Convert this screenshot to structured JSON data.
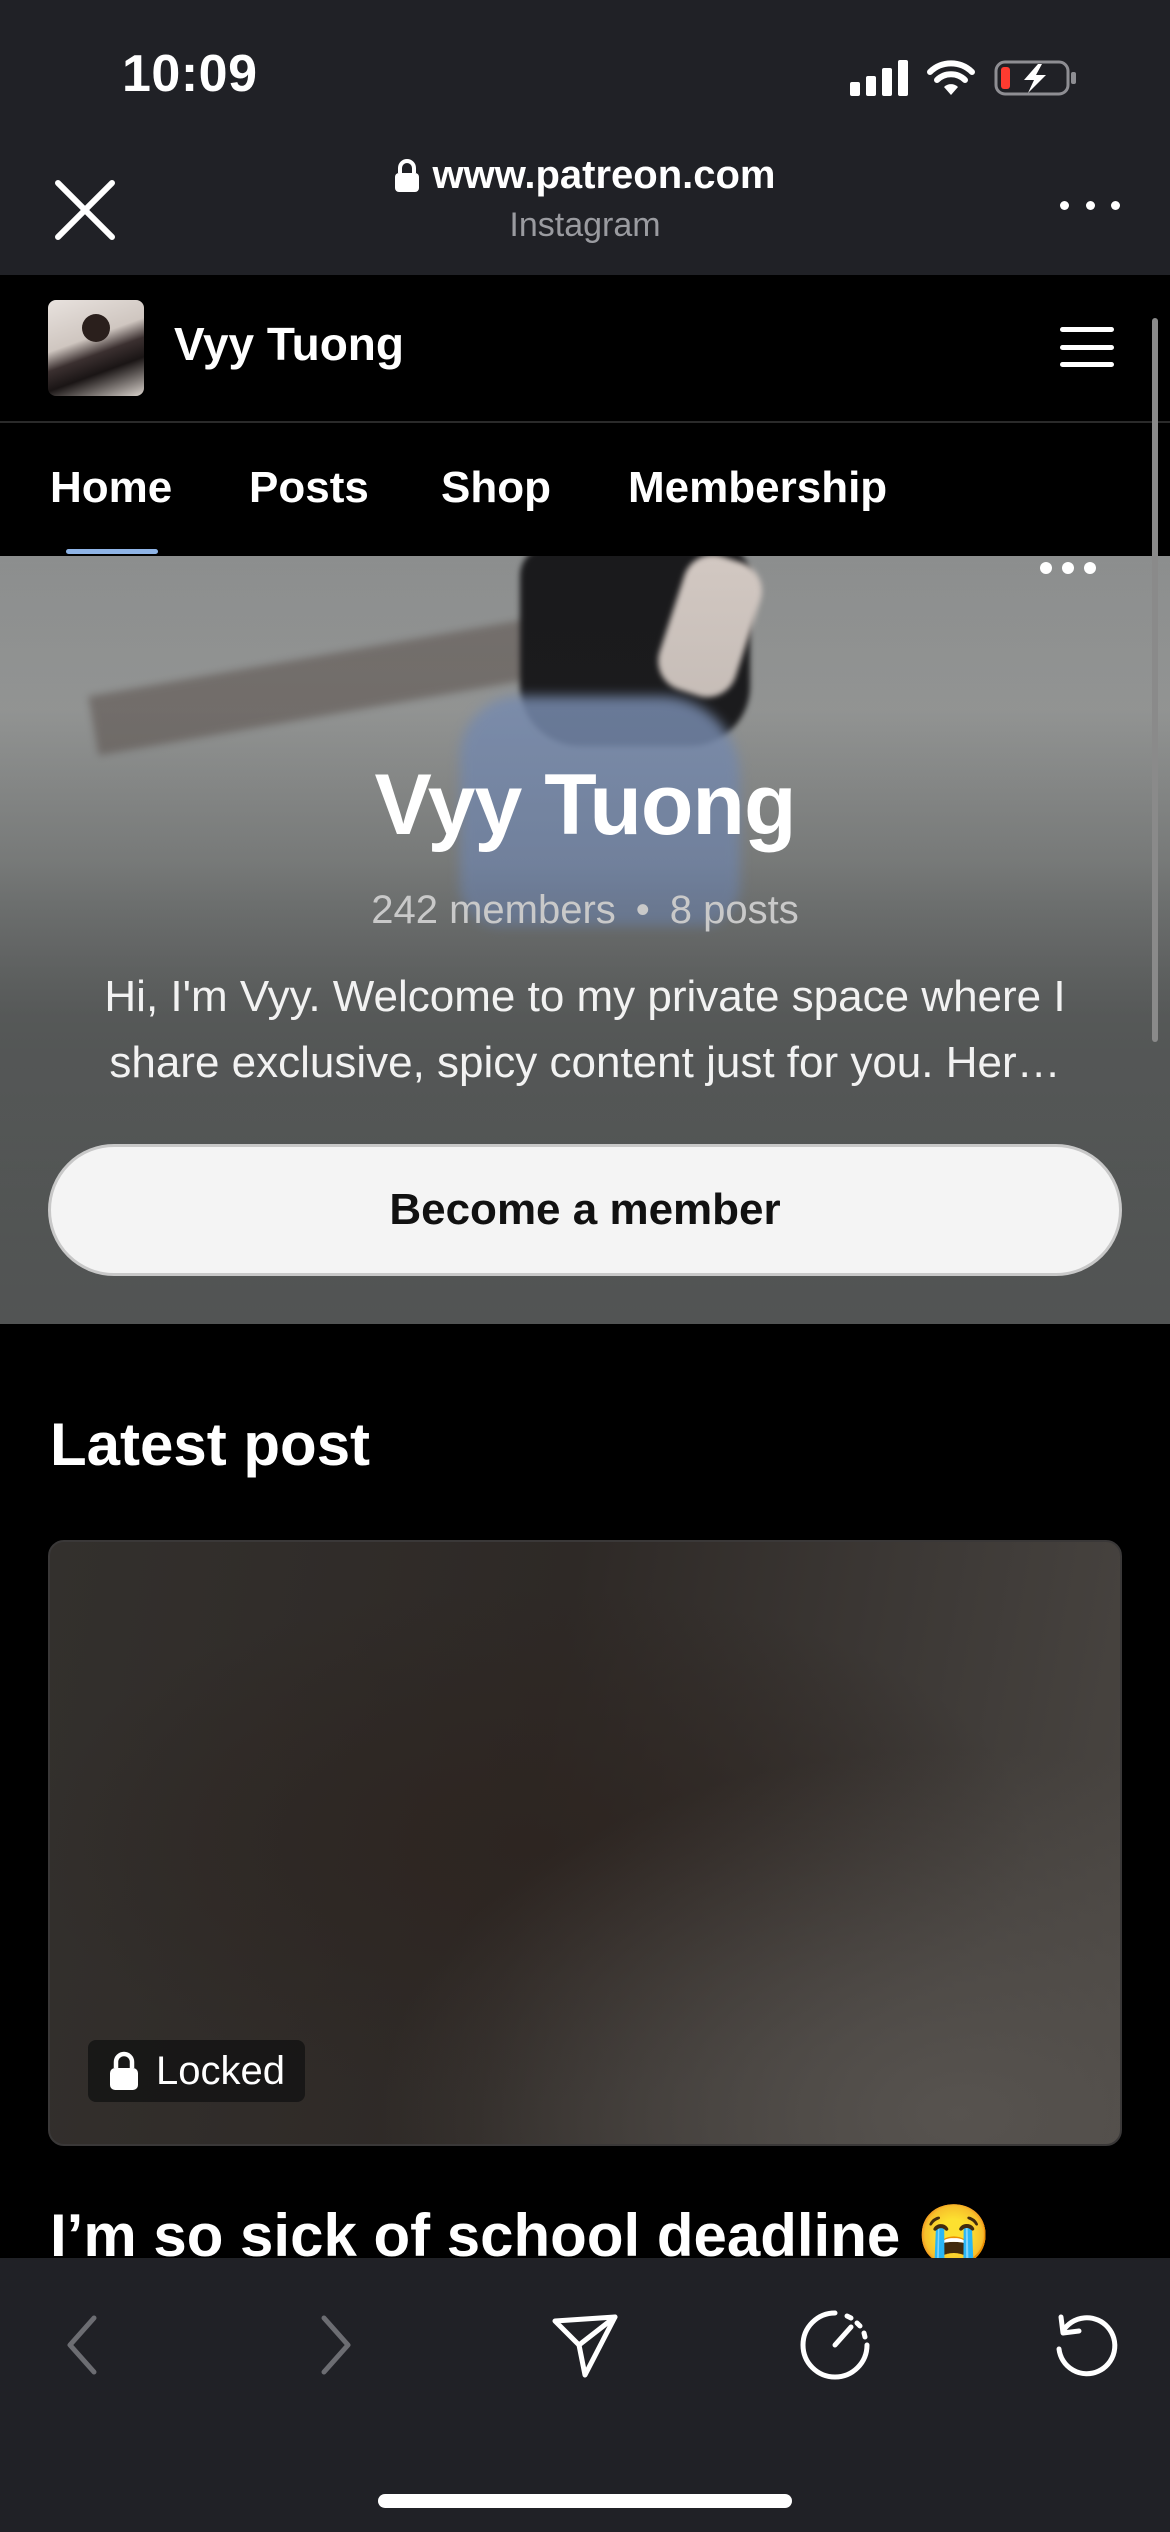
{
  "status_bar": {
    "time": "10:09"
  },
  "browser": {
    "url": "www.patreon.com",
    "source_app": "Instagram"
  },
  "creator": {
    "name": "Vyy Tuong"
  },
  "tabs": [
    {
      "label": "Home",
      "active": true
    },
    {
      "label": "Posts"
    },
    {
      "label": "Shop"
    },
    {
      "label": "Membership"
    }
  ],
  "hero": {
    "title": "Vyy Tuong",
    "members": "242 members",
    "separator": "•",
    "posts": "8 posts",
    "description": "Hi, I'm Vyy. Welcome to my private space where I share exclusive, spicy content just for you. Her…",
    "cta_label": "Become a member"
  },
  "latest_post": {
    "heading": "Latest post",
    "lock_label": "Locked",
    "title": "I’m so sick of school deadline 😭"
  },
  "colors": {
    "chrome_bg": "#202126",
    "page_bg": "#000000",
    "tab_underline": "#8fb4e6",
    "cta_bg": "#f4f4f4"
  },
  "icons": {
    "close": "close-icon",
    "lock": "lock-icon",
    "more": "more-dots-icon",
    "menu": "hamburger-menu-icon",
    "back": "chevron-left-icon",
    "forward": "chevron-right-icon",
    "send": "send-icon",
    "speed": "speedometer-icon",
    "reload": "reload-icon"
  }
}
